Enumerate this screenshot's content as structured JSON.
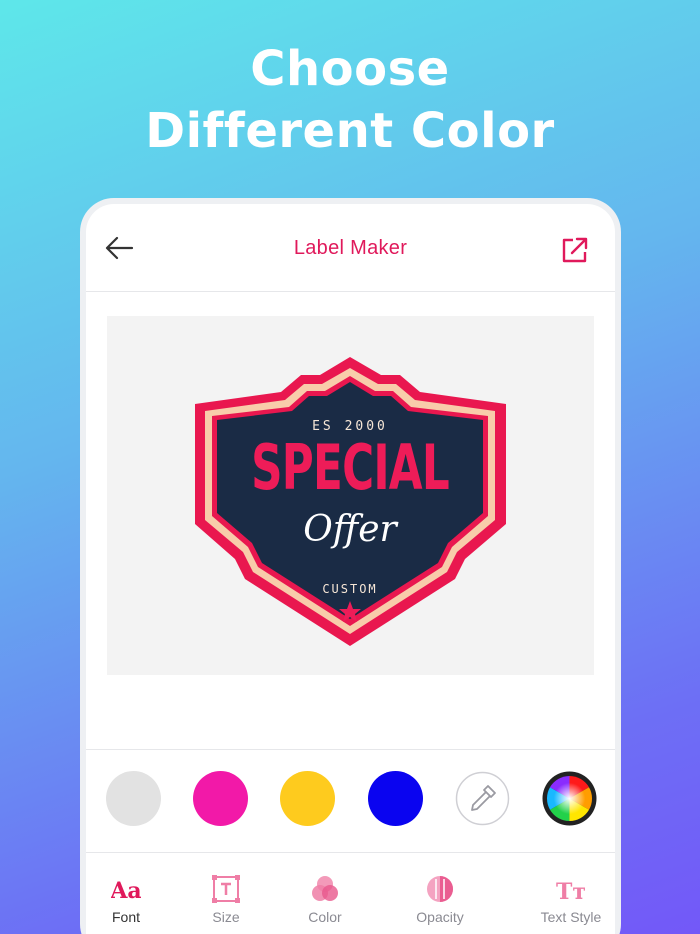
{
  "headline": {
    "line1": "Choose",
    "line2": "Different Color"
  },
  "app": {
    "title": "Label Maker"
  },
  "label": {
    "top_text": "ES 2000",
    "main_text": "SPECIAL",
    "script_text": "Offer",
    "bottom_text": "CUSTOM"
  },
  "palette": {
    "colors": [
      "#e2e2e2",
      "#f219a8",
      "#fecb1e",
      "#0a04f0"
    ],
    "picker_icon": "eyedropper-icon",
    "wheel_icon": "color-wheel-icon"
  },
  "toolbar": {
    "active": "Font",
    "tools": [
      {
        "label": "Font",
        "icon": "font-icon"
      },
      {
        "label": "Size",
        "icon": "size-icon"
      },
      {
        "label": "Color",
        "icon": "color-icon"
      },
      {
        "label": "Opacity",
        "icon": "opacity-icon"
      },
      {
        "label": "Text Style",
        "icon": "text-style-icon"
      }
    ]
  },
  "colors": {
    "accent": "#e0195b",
    "navy": "#1a2b45",
    "cream": "#f8ccaa",
    "badge_red": "#e9174f"
  }
}
